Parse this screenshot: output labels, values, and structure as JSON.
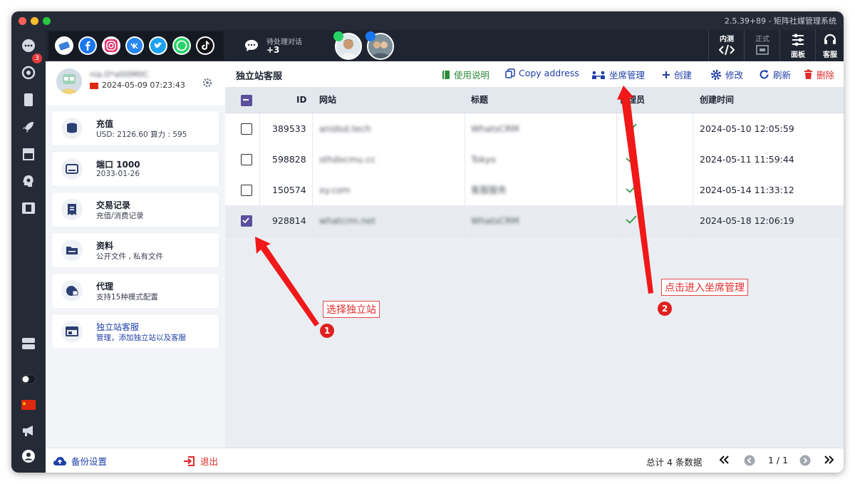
{
  "window": {
    "title": "2.5.39+89 - 矩阵社媒管理系统"
  },
  "rail": {
    "badge_count": "3"
  },
  "topbar": {
    "pending_label": "待处理对话",
    "pending_count": "+3",
    "tools": [
      {
        "label": "内测",
        "icon": "code-icon"
      },
      {
        "label": "正式",
        "icon": "window-icon"
      },
      {
        "label": "面板",
        "icon": "sliders-icon"
      },
      {
        "label": "客服",
        "icon": "headset-icon"
      }
    ]
  },
  "profile": {
    "name": "nia.O*a0l0M0C",
    "datetime": "2024-05-09 07:23:43"
  },
  "sidebar": {
    "items": [
      {
        "title": "充值",
        "sub": "USD: 2126.60  算力 : 595",
        "icon": "coins-icon"
      },
      {
        "title": "端口 1000",
        "sub": "2033-01-26",
        "icon": "drive-icon"
      },
      {
        "title": "交易记录",
        "sub": "充值/消费记录",
        "icon": "receipt-icon"
      },
      {
        "title": "资料",
        "sub": "公开文件 , 私有文件",
        "icon": "folder-icon"
      },
      {
        "title": "代理",
        "sub": "支持15种模式配置",
        "icon": "globe-lock-icon"
      },
      {
        "title": "独立站客服",
        "sub": "管理，添加独立站以及客服",
        "icon": "browser-icon"
      }
    ],
    "backup_label": "备份设置",
    "logout_label": "退出"
  },
  "main": {
    "title": "独立站客服",
    "actions": {
      "help": "使用说明",
      "copy": "Copy address",
      "seats": "坐席管理",
      "create": "创建",
      "edit": "修改",
      "refresh": "刷新",
      "delete": "删除"
    },
    "columns": {
      "id": "ID",
      "site": "网站",
      "title": "标题",
      "admin": "管理员",
      "created": "创建时间"
    },
    "rows": [
      {
        "id": "389533",
        "site": "anidsd.tech",
        "title": "WhatsCRM",
        "created": "2024-05-10 12:05:59",
        "selected": false
      },
      {
        "id": "598828",
        "site": "sthdxcmu.cc",
        "title": "Tokyo",
        "created": "2024-05-11 11:59:44",
        "selected": false
      },
      {
        "id": "150574",
        "site": "xy.com",
        "title": "客服服务",
        "created": "2024-05-14 11:33:12",
        "selected": false
      },
      {
        "id": "928814",
        "site": "whatcrm.net",
        "title": "WhatsCRM",
        "created": "2024-05-18 12:06:19",
        "selected": true
      }
    ],
    "footer": {
      "total": "总计 4 条数据",
      "page": "1 / 1"
    }
  },
  "annotations": {
    "one": {
      "number": "1",
      "text": "选择独立站"
    },
    "two": {
      "number": "2",
      "text": "点击进入坐席管理"
    }
  },
  "colors": {
    "accent": "#5c4f9e",
    "rail": "#252b36",
    "danger": "#e12b2b",
    "link": "#1f3fa8",
    "green": "#2d8a3a"
  }
}
